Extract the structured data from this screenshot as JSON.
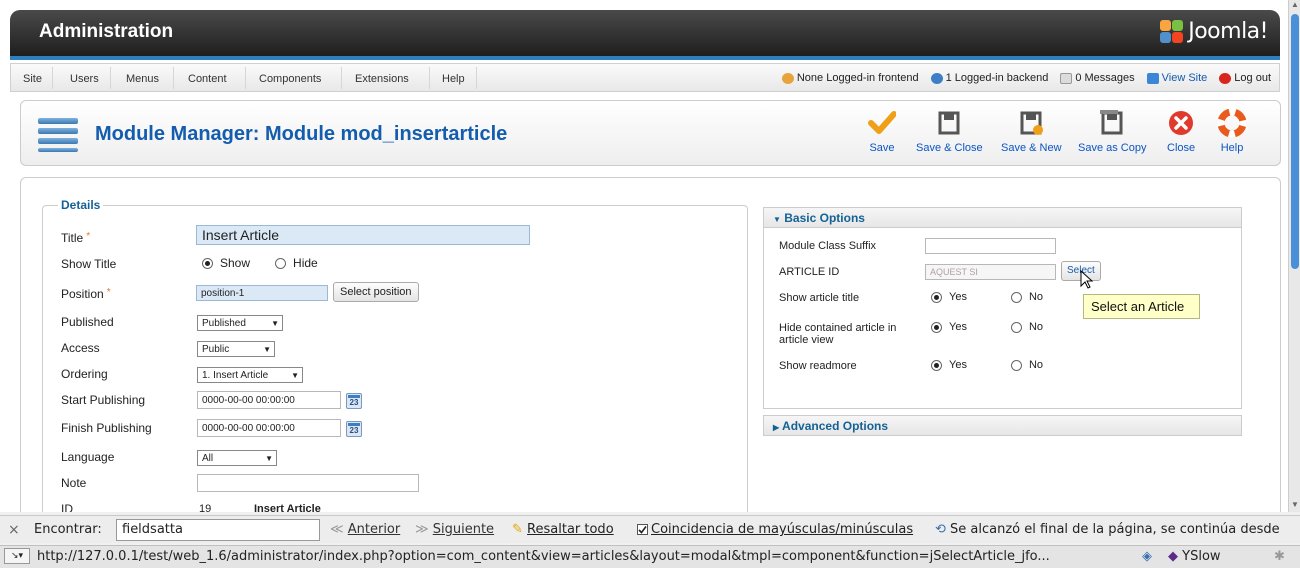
{
  "header": {
    "title": "Administration",
    "brand": "Joomla!"
  },
  "menu": {
    "items": [
      "Site",
      "Users",
      "Menus",
      "Content",
      "Components",
      "Extensions",
      "Help"
    ],
    "status": {
      "frontend": "None Logged-in frontend",
      "backend": "1 Logged-in backend",
      "messages": "0 Messages",
      "view_site": "View Site",
      "logout": "Log out"
    }
  },
  "toolbar": {
    "page_title": "Module Manager: Module mod_insertarticle",
    "buttons": {
      "save": "Save",
      "save_close": "Save & Close",
      "save_new": "Save & New",
      "save_copy": "Save as Copy",
      "close": "Close",
      "help": "Help"
    }
  },
  "details": {
    "legend": "Details",
    "title_label": "Title",
    "title_value": "Insert Article",
    "show_title_label": "Show Title",
    "show_label": "Show",
    "hide_label": "Hide",
    "position_label": "Position",
    "position_value": "position-1",
    "select_position": "Select position",
    "published_label": "Published",
    "published_value": "Published",
    "access_label": "Access",
    "access_value": "Public",
    "ordering_label": "Ordering",
    "ordering_value": "1. Insert Article",
    "start_publishing_label": "Start Publishing",
    "start_publishing_value": "0000-00-00 00:00:00",
    "finish_publishing_label": "Finish Publishing",
    "finish_publishing_value": "0000-00-00 00:00:00",
    "calendar_day": "23",
    "language_label": "Language",
    "language_value": "All",
    "note_label": "Note",
    "note_value": "",
    "id_label": "ID",
    "id_value": "19",
    "id_title": "Insert Article"
  },
  "basic_options": {
    "header": "Basic Options",
    "module_class_suffix_label": "Module Class Suffix",
    "module_class_suffix_value": "",
    "article_id_label": "ARTICLE ID",
    "article_id_value": "AQUEST SI",
    "select_button": "Select",
    "show_article_title_label": "Show article title",
    "hide_contained_label": "Hide contained article in article view",
    "show_readmore_label": "Show readmore",
    "yes": "Yes",
    "no": "No",
    "tooltip": "Select an Article"
  },
  "advanced_options": {
    "header": "Advanced Options"
  },
  "findbar": {
    "label": "Encontrar:",
    "query": "fieldsatta",
    "previous": "Anterior",
    "next": "Siguiente",
    "highlight_all": "Resaltar todo",
    "match_case": "Coincidencia de mayúsculas/minúsculas",
    "message": "Se alcanzó el final de la página, se continúa desde"
  },
  "statusbar": {
    "url": "http://127.0.0.1/test/web_1.6/administrator/index.php?option=com_content&view=articles&layout=modal&tmpl=component&function=jSelectArticle_jfo...",
    "yslow": "YSlow"
  }
}
